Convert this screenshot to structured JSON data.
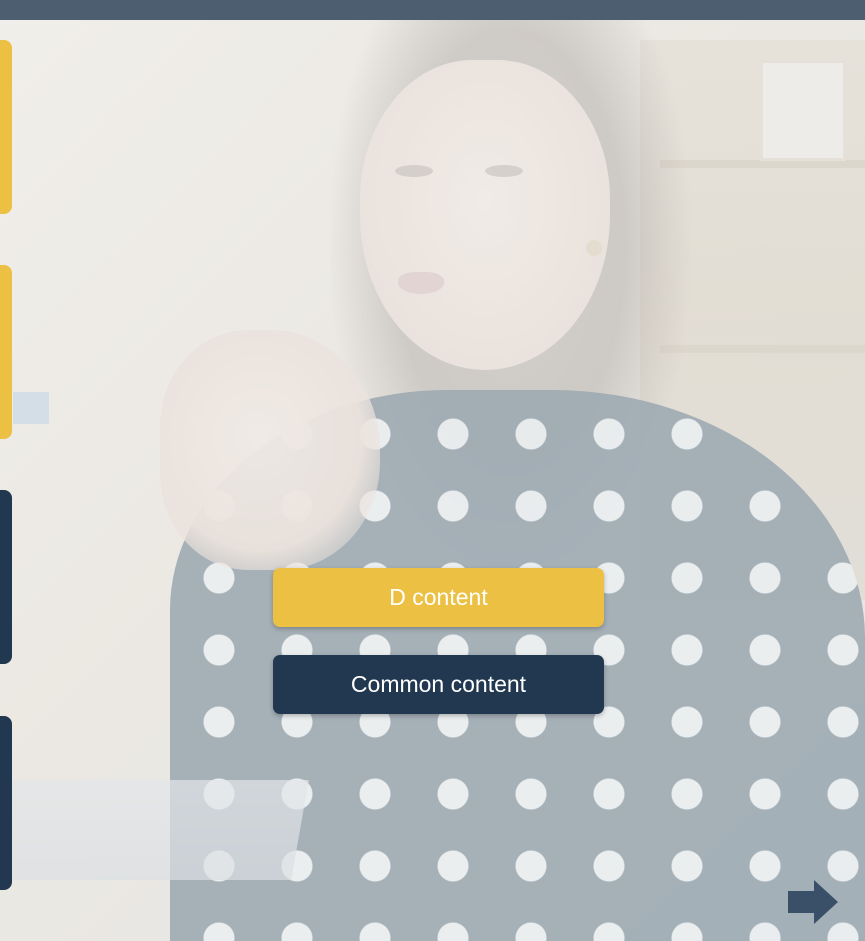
{
  "buttons": {
    "primary_label": "D content",
    "secondary_label": "Common content"
  },
  "side_tabs": [
    {
      "color": "#ecc043"
    },
    {
      "color": "#ecc043"
    },
    {
      "color": "#223850"
    },
    {
      "color": "#223850"
    }
  ],
  "colors": {
    "accent_yellow": "#ecc043",
    "navy": "#223850",
    "top_bar": "#4c5e70",
    "arrow": "#3a5068"
  },
  "icons": {
    "next": "arrow-right-icon"
  }
}
